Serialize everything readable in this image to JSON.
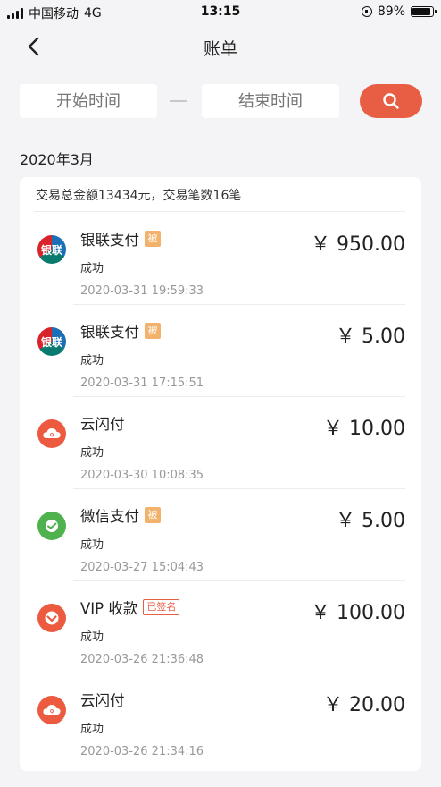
{
  "status_bar": {
    "carrier": "中国移动",
    "network": "4G",
    "time": "13:15",
    "battery": "89%",
    "battery_level": 0.89
  },
  "nav": {
    "title": "账单",
    "back_icon": "chevron-left-icon"
  },
  "search": {
    "start_placeholder": "开始时间",
    "end_placeholder": "结束时间",
    "button_icon": "search-icon",
    "button_color": "#e85e44"
  },
  "month": "2020年3月",
  "summary": "交易总金额13434元，交易笔数16笔",
  "transactions": [
    {
      "name": "银联支付",
      "tag": "被",
      "tag_type": "bei",
      "logo": "unionpay-logo",
      "logo_text": "银联",
      "status": "成功",
      "time": "2020-03-31 19:59:33",
      "amount": "￥ 950.00"
    },
    {
      "name": "银联支付",
      "tag": "被",
      "tag_type": "bei",
      "logo": "unionpay-logo",
      "logo_text": "银联",
      "status": "成功",
      "time": "2020-03-31 17:15:51",
      "amount": "￥ 5.00"
    },
    {
      "name": "云闪付",
      "tag": "",
      "tag_type": "none",
      "logo": "cloud-quickpass-logo",
      "logo_text": "",
      "status": "成功",
      "time": "2020-03-30 10:08:35",
      "amount": "￥ 10.00"
    },
    {
      "name": "微信支付",
      "tag": "被",
      "tag_type": "bei",
      "logo": "wechat-pay-logo",
      "logo_text": "",
      "status": "成功",
      "time": "2020-03-27 15:04:43",
      "amount": "￥ 5.00"
    },
    {
      "name": "VIP 收款",
      "tag": "已签名",
      "tag_type": "signed",
      "logo": "vip-collect-logo",
      "logo_text": "",
      "status": "成功",
      "time": "2020-03-26 21:36:48",
      "amount": "￥ 100.00"
    },
    {
      "name": "云闪付",
      "tag": "",
      "tag_type": "none",
      "logo": "cloud-quickpass-logo",
      "logo_text": "",
      "status": "成功",
      "time": "2020-03-26 21:34:16",
      "amount": "￥ 20.00"
    }
  ]
}
